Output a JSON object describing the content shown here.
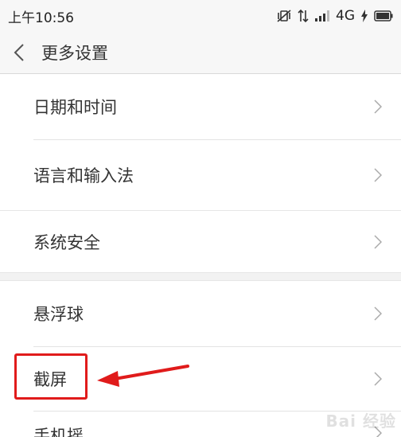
{
  "status_bar": {
    "time": "上午10:56",
    "network": "4G"
  },
  "header": {
    "title": "更多设置"
  },
  "settings": {
    "group1": [
      {
        "label": "日期和时间"
      },
      {
        "label": "语言和输入法"
      }
    ],
    "group2": [
      {
        "label": "系统安全"
      }
    ],
    "group3": [
      {
        "label": "悬浮球"
      },
      {
        "label": "截屏"
      }
    ],
    "partial_item": "手机摇"
  },
  "annotation": {
    "highlight_color": "#e01b1b"
  },
  "watermark": "Bai 经验"
}
